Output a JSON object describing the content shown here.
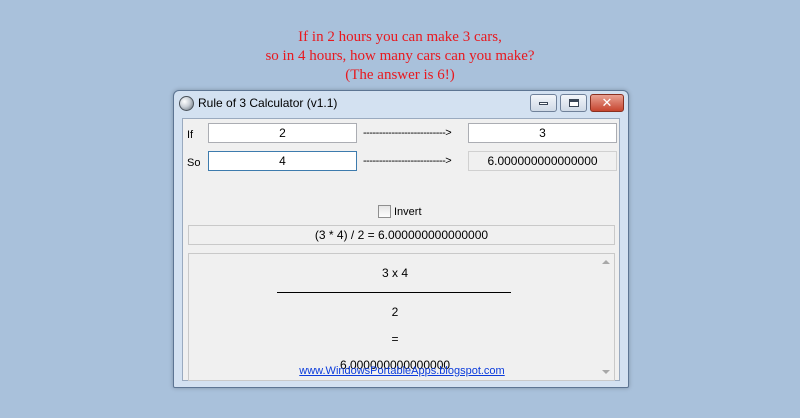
{
  "caption": {
    "line1": "If in 2 hours you can make 3 cars,",
    "line2": "so in 4 hours, how many cars can you make?",
    "line3": "(The answer is 6!)"
  },
  "window": {
    "title": "Rule of 3 Calculator (v1.1)",
    "close_glyph": "✕"
  },
  "row1": {
    "label": "If",
    "input_a": "2",
    "arrow": "-------------------------->",
    "input_b": "3"
  },
  "row2": {
    "label": "So",
    "input_a": "4",
    "arrow": "-------------------------->",
    "result": "6.000000000000000"
  },
  "invert": {
    "label": "Invert",
    "checked": false
  },
  "result_bar": "(3 * 4) / 2 = 6.000000000000000",
  "formula": {
    "numerator": "3 x 4",
    "denominator": "2",
    "equals": "=",
    "result": "6.000000000000000"
  },
  "footer_link": "www.WindowsPortableApps.blogspot.com",
  "colors": {
    "caption": "#e8191f",
    "background": "#a9c1db",
    "link": "#0a3bdb"
  }
}
